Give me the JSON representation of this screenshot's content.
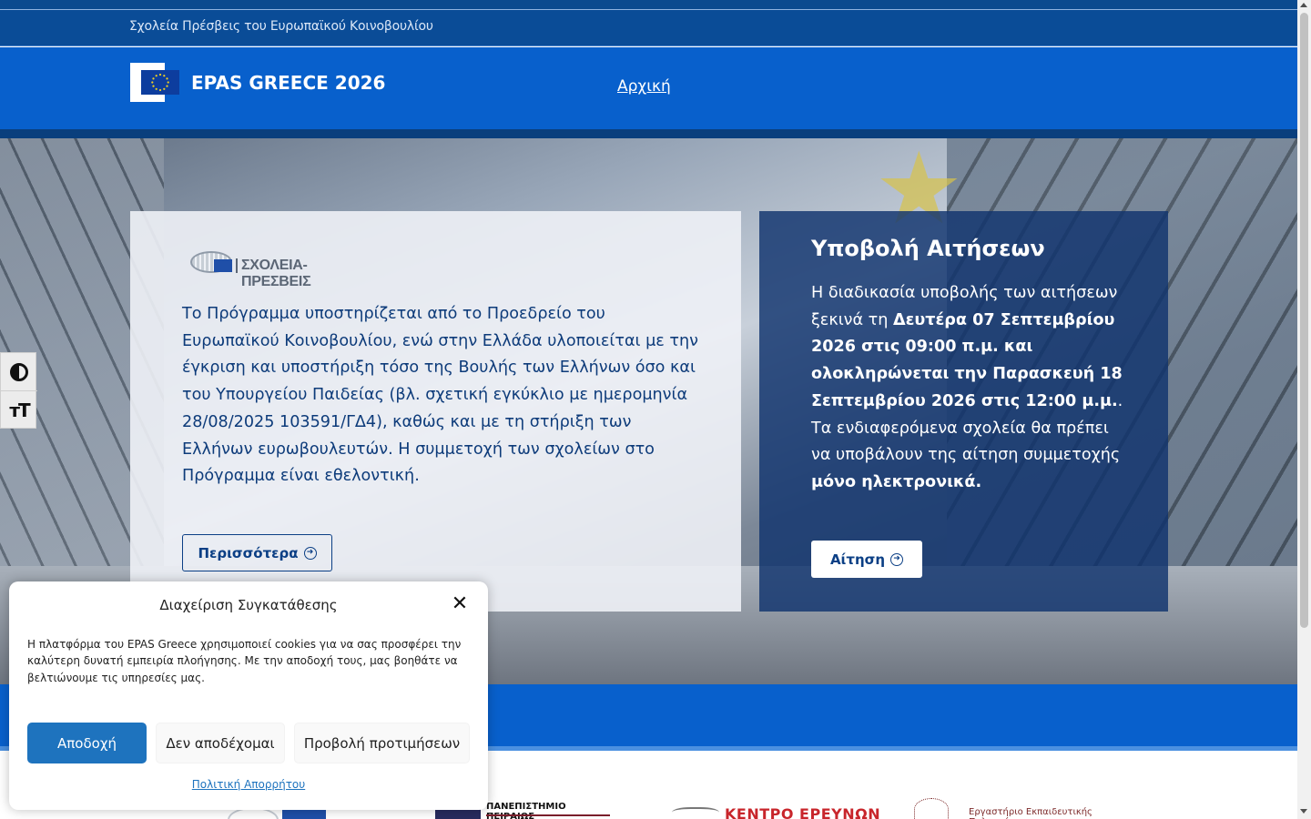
{
  "topbar": {
    "subtitle": "Σχολεία Πρέσβεις του Ευρωπαϊκού Κοινοβουλίου"
  },
  "header": {
    "brand": "EPAS GREECE 2026",
    "nav_home": "Αρχική"
  },
  "hero": {
    "left_card": {
      "logo_text": "ΣΧΟΛΕΙΑ-ΠΡΕΣΒΕΙΣ",
      "paragraph": "Το Πρόγραμμα υποστηρίζεται από το Προεδρείο του Ευρωπαϊκού Κοινοβουλίου, ενώ στην Ελλάδα υλοποιείται με την έγκριση και υποστήριξη τόσο της Βουλής των Ελλήνων όσο και του Υπουργείου Παιδείας (βλ. σχετική εγκύκλιο με ημερομηνία 28/08/2025 103591/ΓΔ4), καθώς και με τη στήριξη των Ελλήνων ευρωβουλευτών. Η συμμετοχή των σχολείων στο Πρόγραμμα είναι εθελοντική.",
      "button": "Περισσότερα"
    },
    "right_card": {
      "title": "Υποβολή Αιτήσεων",
      "text_1": "Η διαδικασία υποβολής των αιτήσεων ξεκινά τη ",
      "text_bold_1": "Δευτέρα 07 Σεπτεμβρίου 2026 στις 09:00 π.μ. και ολοκληρώνεται την Παρασκευή 18 Σεπτεμβρίου 2026 στις 12:00 μ.μ.",
      "text_2": ". Τα ενδιαφερόμενα σχολεία θα πρέπει να υποβάλουν της αίτηση συμμετοχής ",
      "text_bold_2": "μόνο ηλεκτρονικά.",
      "button": "Αίτηση"
    }
  },
  "accessibility": {
    "contrast_icon": "contrast-icon",
    "text_size_icon": "text-size-icon"
  },
  "partners": [
    {
      "name": "ΠΑΝΕΠΙΣΤΗΜΙΟ ΠΕΙΡΑΙΩΣ"
    },
    {
      "name": "ΚΕΝΤΡΟ ΕΡΕΥΝΩΝ"
    },
    {
      "name": "Εργαστήριο Εκπαιδευτικής Πολιτικής,"
    }
  ],
  "cookie": {
    "title": "Διαχείριση Συγκατάθεσης",
    "body": "Η πλατφόρμα του EPAS Greece χρησιμοποιεί cookies για να σας προσφέρει την καλύτερη δυνατή εμπειρία πλοήγησης. Με την αποδοχή τους, μας βοηθάτε να βελτιώνουμε τις υπηρεσίες μας.",
    "accept": "Αποδοχή",
    "deny": "Δεν αποδέχομαι",
    "preferences": "Προβολή προτιμήσεων",
    "privacy_link": "Πολιτική Απορρήτου"
  },
  "colors": {
    "primary_blue": "#0860cc",
    "dark_blue": "#0a3f7d",
    "accept_blue": "#1e73be"
  }
}
